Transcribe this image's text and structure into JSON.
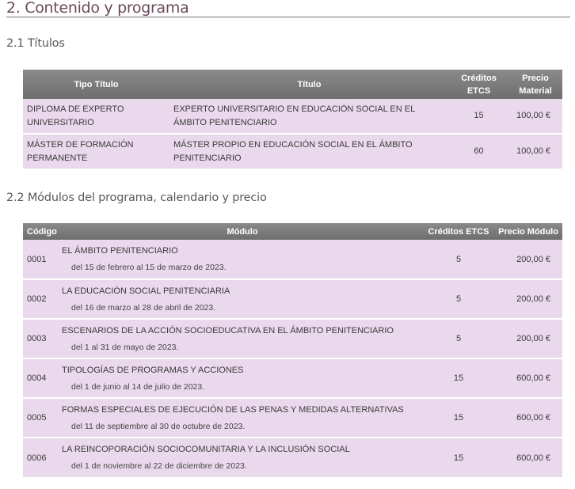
{
  "section_title": "2. Contenido y programa",
  "titulos": {
    "heading": "2.1 Títulos",
    "headers": {
      "tipo": "Tipo Título",
      "titulo": "Título",
      "creditos": "Créditos ETCS",
      "precio": "Precio Material"
    },
    "rows": [
      {
        "tipo": "DIPLOMA DE EXPERTO UNIVERSITARIO",
        "titulo": "EXPERTO UNIVERSITARIO EN EDUCACIÓN SOCIAL EN EL ÁMBITO PENITENCIARIO",
        "creditos": "15",
        "precio": "100,00 €"
      },
      {
        "tipo": "MÁSTER DE FORMACIÓN PERMANENTE",
        "titulo": "MÁSTER PROPIO EN EDUCACIÓN SOCIAL EN EL ÁMBITO PENITENCIARIO",
        "creditos": "60",
        "precio": "100,00 €"
      }
    ]
  },
  "modulos": {
    "heading": "2.2 Módulos del programa, calendario y precio",
    "headers": {
      "codigo": "Código",
      "modulo": "Módulo",
      "creditos": "Créditos ETCS",
      "precio": "Precio Módulo"
    },
    "rows": [
      {
        "codigo": "0001",
        "modulo": "EL ÁMBITO PENITENCIARIO",
        "fechas": "del 15 de febrero al 15 de marzo de 2023.",
        "creditos": "5",
        "precio": "200,00 €"
      },
      {
        "codigo": "0002",
        "modulo": "LA EDUCACIÓN SOCIAL PENITENCIARIA",
        "fechas": "del 16 de marzo al 28 de abril de 2023.",
        "creditos": "5",
        "precio": "200,00 €"
      },
      {
        "codigo": "0003",
        "modulo": "ESCENARIOS DE LA ACCIÓN SOCIOEDUCATIVA EN EL ÁMBITO PENITENCIARIO",
        "fechas": "del 1 al 31 de mayo de 2023.",
        "creditos": "5",
        "precio": "200,00 €"
      },
      {
        "codigo": "0004",
        "modulo": "TIPOLOGÍAS DE PROGRAMAS Y ACCIONES",
        "fechas": "del 1 de junio al 14 de julio de 2023.",
        "creditos": "15",
        "precio": "600,00 €"
      },
      {
        "codigo": "0005",
        "modulo": "FORMAS ESPECIALES DE EJECUCIÓN DE LAS PENAS Y MEDIDAS ALTERNATIVAS",
        "fechas": "del 11 de septiembre al 30 de octubre de 2023.",
        "creditos": "15",
        "precio": "600,00 €"
      },
      {
        "codigo": "0006",
        "modulo": "LA REINCOPORACIÓN SOCIOCOMUNITARIA Y LA INCLUSIÓN SOCIAL",
        "fechas": "del 1 de noviembre al 22 de diciembre de 2023.",
        "creditos": "15",
        "precio": "600,00 €"
      }
    ]
  }
}
